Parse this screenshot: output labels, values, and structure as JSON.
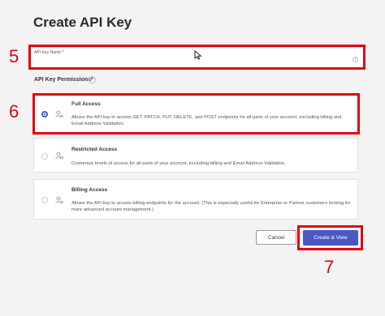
{
  "page": {
    "title": "Create API Key"
  },
  "name_field": {
    "label": "API Key Name",
    "required_mark": "*",
    "value": "",
    "info_icon": "info-icon"
  },
  "permissions": {
    "label": "API Key Permissions*",
    "options": [
      {
        "title": "Full Access",
        "description": "Allows the API key to access GET, PATCH, PUT, DELETE, and POST endpoints for all parts of your account, excluding billing and Email Address Validation.",
        "selected": true,
        "icon": "person-gear-icon"
      },
      {
        "title": "Restricted Access",
        "description": "Customize levels of access for all parts of your account, excluding billing and Email Address Validation.",
        "selected": false,
        "icon": "person-gear-icon"
      },
      {
        "title": "Billing Access",
        "description": "Allows the API key to access billing endpoints for the account. (This is especially useful for Enterprise or Partner customers looking for more advanced account management.)",
        "selected": false,
        "icon": "person-gear-icon"
      }
    ]
  },
  "actions": {
    "cancel_label": "Cancel",
    "create_label": "Create & View"
  },
  "annotations": {
    "step_5": "5",
    "step_6": "6",
    "step_7": "7"
  },
  "colors": {
    "accent": "#4a57c4",
    "highlight": "#e3000f",
    "background": "#f3f3f3"
  }
}
